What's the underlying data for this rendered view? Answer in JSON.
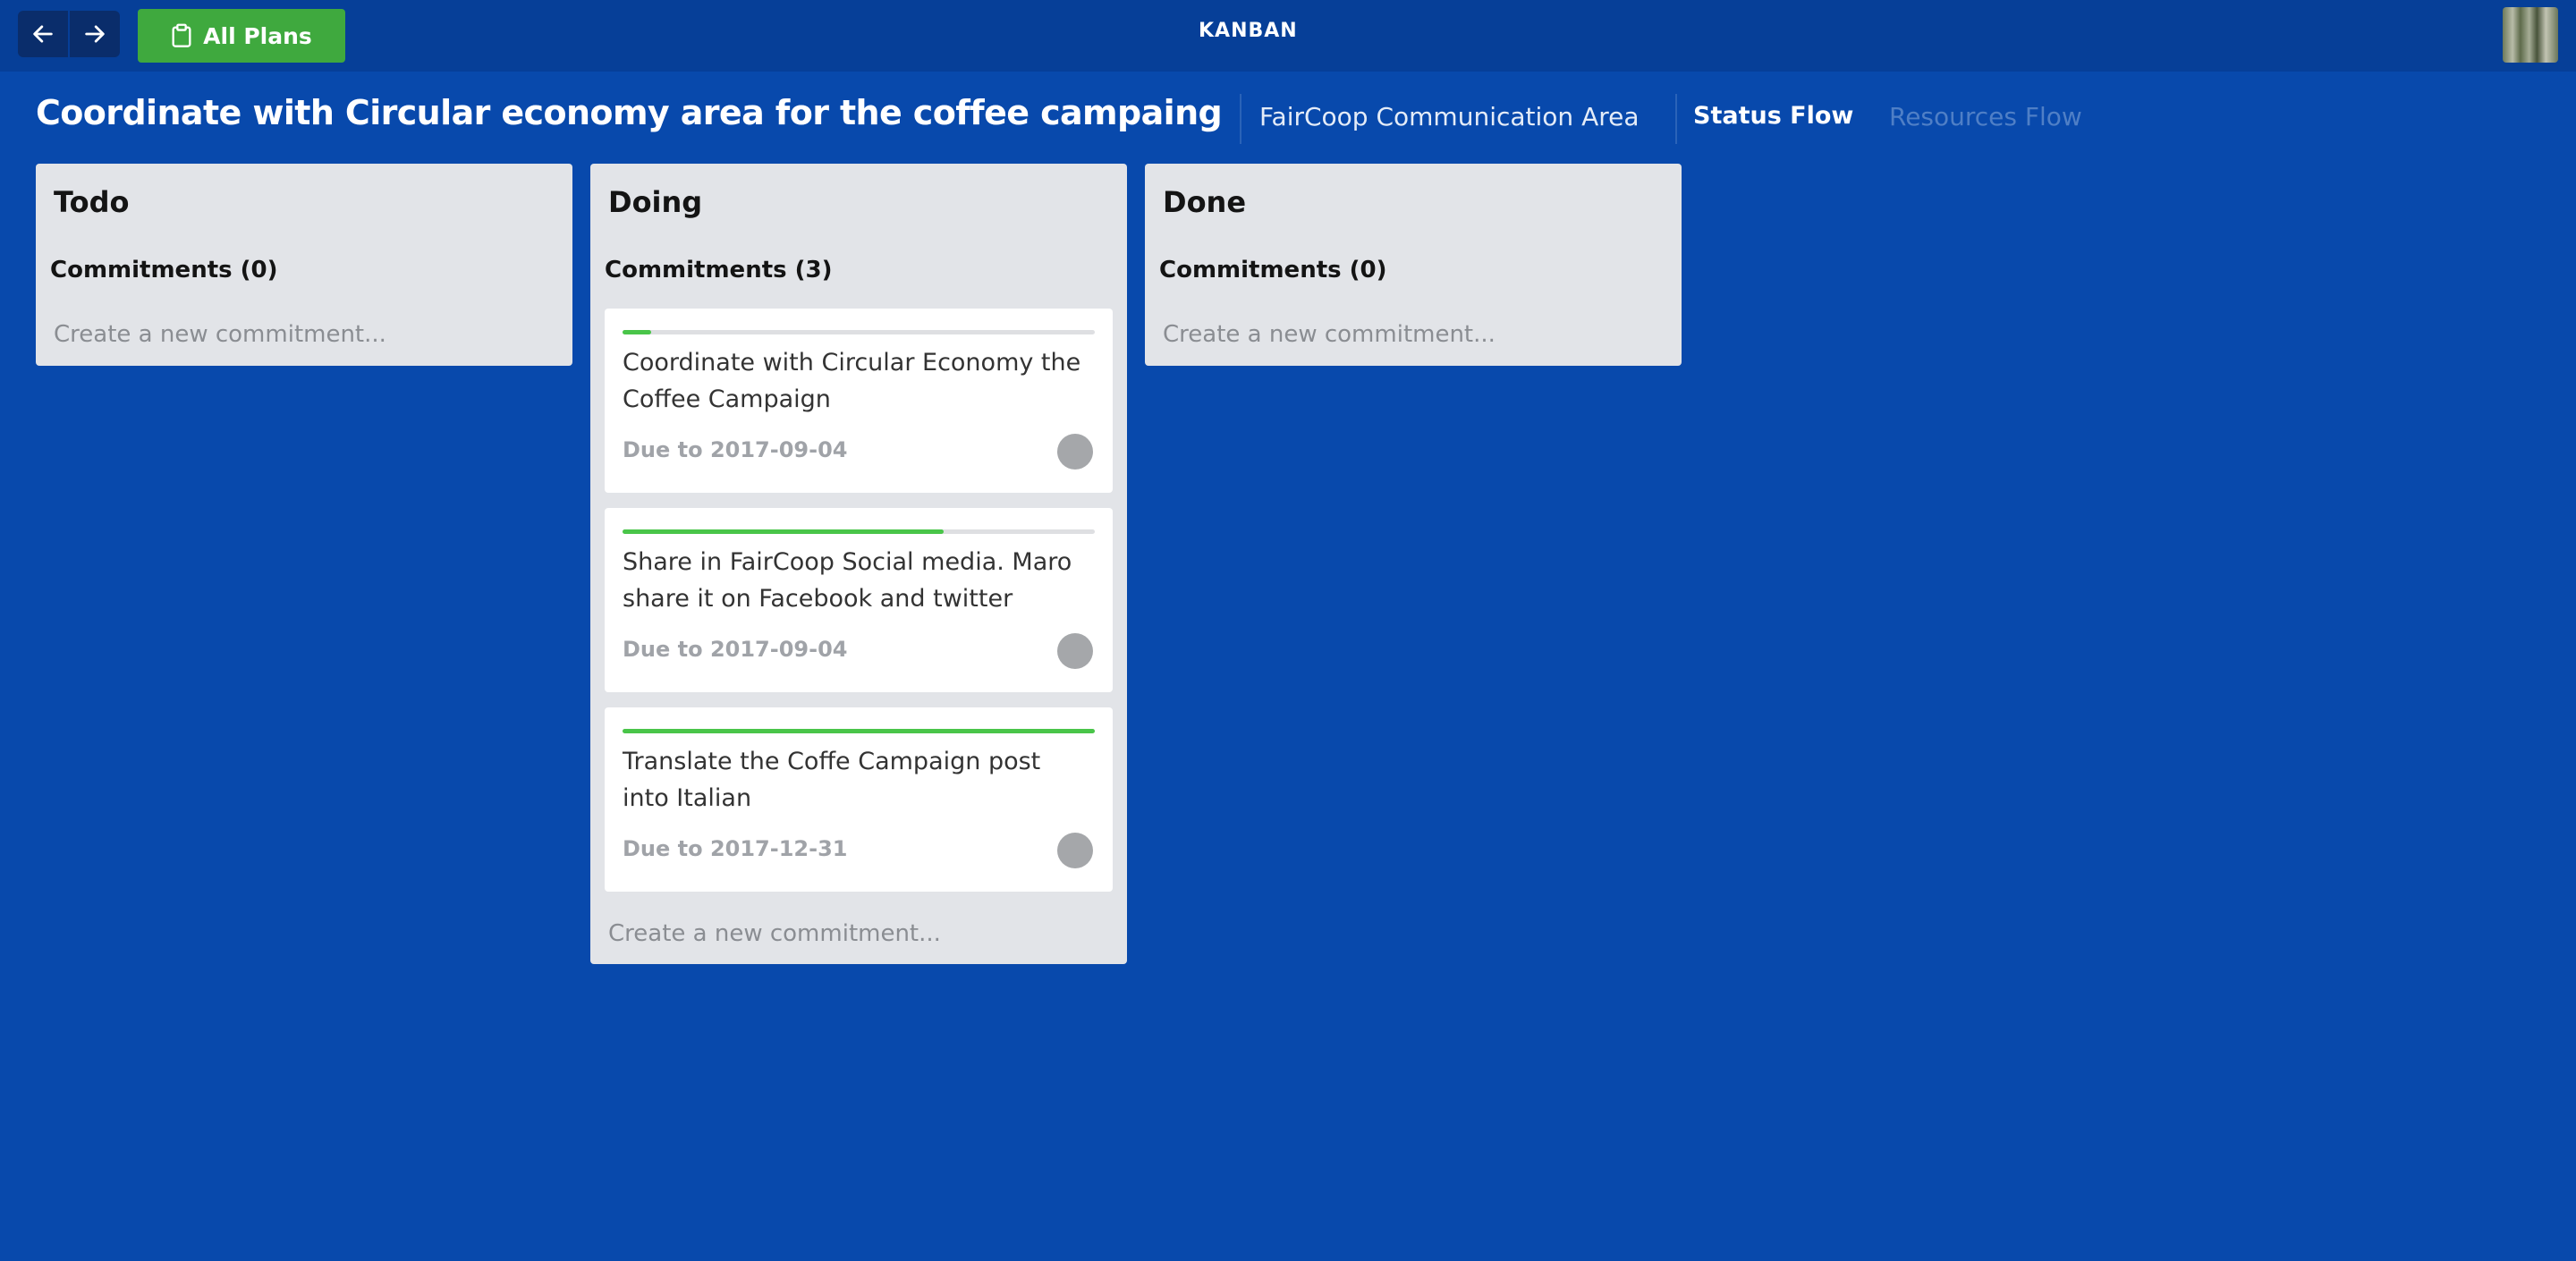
{
  "topbar": {
    "back_icon": "arrow-left-icon",
    "forward_icon": "arrow-right-icon",
    "all_plans_icon": "clipboard-icon",
    "all_plans_label": "All Plans",
    "title": "KANBAN",
    "user_avatar": "user-avatar"
  },
  "header": {
    "title": "Coordinate with Circular economy area for the coffee campaing",
    "area": "FairCoop Communication Area",
    "tabs": [
      {
        "label": "Status Flow",
        "active": true
      },
      {
        "label": "Resources Flow",
        "active": false
      }
    ]
  },
  "columns": [
    {
      "title": "Todo",
      "count_label": "Commitments (0)",
      "create_placeholder": "Create a new commitment..."
    },
    {
      "title": "Doing",
      "count_label": "Commitments (3)",
      "create_placeholder": "Create a new commitment...",
      "cards": [
        {
          "title": "Coordinate with Circular Economy the Coffee Campaign",
          "due": "Due to 2017-09-04",
          "progress": 0.06
        },
        {
          "title": "Share in FairCoop Social media. Maro share it on Facebook and twitter",
          "due": "Due to 2017-09-04",
          "progress": 0.68
        },
        {
          "title": "Translate the Coffe Campaign post into Italian",
          "due": "Due to 2017-12-31",
          "progress": 1.0
        }
      ]
    },
    {
      "title": "Done",
      "count_label": "Commitments (0)",
      "create_placeholder": "Create a new commitment..."
    }
  ],
  "colors": {
    "background": "#0849ac",
    "topbar": "#063f98",
    "accent_green": "#3fa93e",
    "progress_green": "#49c549",
    "column_bg": "#e2e4e8"
  }
}
